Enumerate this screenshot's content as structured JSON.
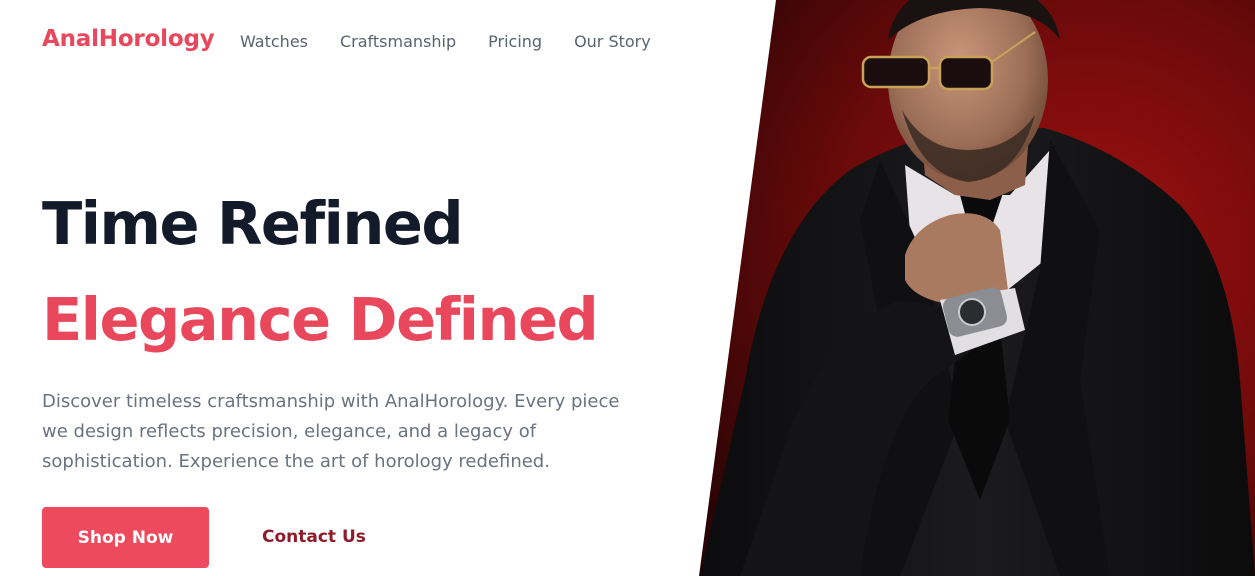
{
  "header": {
    "brand": "AnalHorology",
    "nav": [
      {
        "label": "Watches"
      },
      {
        "label": "Craftsmanship"
      },
      {
        "label": "Pricing"
      },
      {
        "label": "Our Story"
      }
    ]
  },
  "hero": {
    "headline_line1": "Time Refined",
    "headline_line2": "Elegance Defined",
    "description": "Discover timeless craftsmanship with AnalHorology. Every piece we design reflects precision, elegance, and a legacy of sophistication. Experience the art of horology redefined.",
    "primary_button": "Shop Now",
    "secondary_button": "Contact Us"
  },
  "theme": {
    "accent": "#e8475c",
    "button": "#ee4a5e",
    "heading": "#131a2a",
    "body_text": "#6b7280",
    "nav_text": "#5b6270",
    "link": "#8e1c2b",
    "image_background": "#7a0c0c"
  }
}
